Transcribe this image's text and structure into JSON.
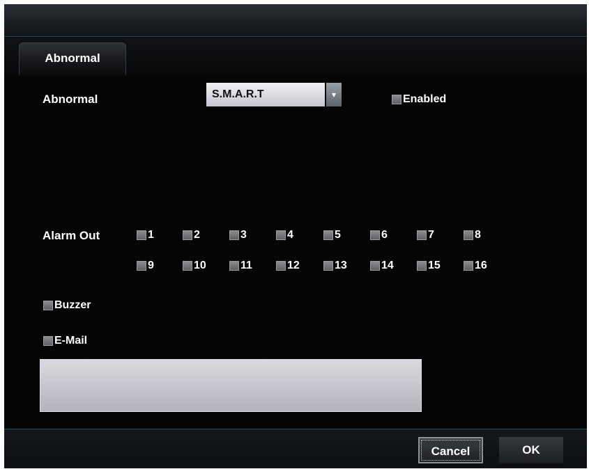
{
  "tabs": [
    {
      "label": "Abnormal"
    }
  ],
  "abnormal": {
    "label": "Abnormal",
    "type_value": "S.M.A.R.T",
    "enabled_label": "Enabled"
  },
  "alarm_out": {
    "label": "Alarm Out",
    "outputs": [
      "1",
      "2",
      "3",
      "4",
      "5",
      "6",
      "7",
      "8",
      "9",
      "10",
      "11",
      "12",
      "13",
      "14",
      "15",
      "16"
    ]
  },
  "buzzer_label": "Buzzer",
  "email_label": "E-Mail",
  "email_value": "",
  "buttons": {
    "cancel": "Cancel",
    "ok": "OK"
  },
  "icons": {
    "dropdown": "chevron-down-icon"
  }
}
